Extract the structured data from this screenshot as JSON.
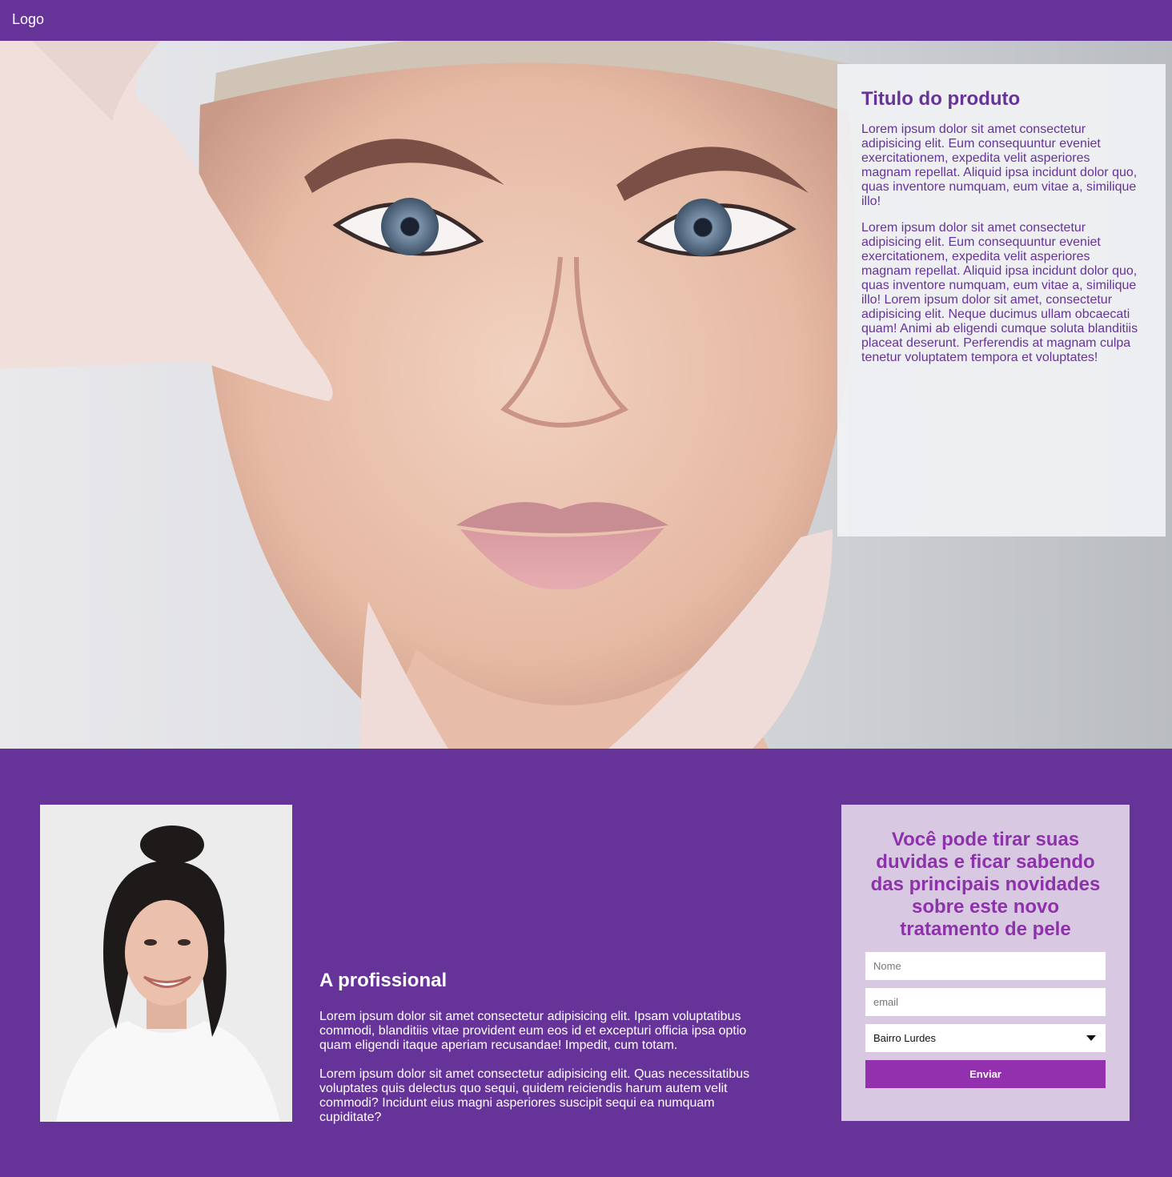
{
  "header": {
    "logo": "Logo"
  },
  "hero": {
    "image": "hero-photo",
    "product_title": "Titulo do produto",
    "paragraphs": [
      "Lorem ipsum dolor sit amet consectetur adipisicing elit. Eum consequuntur eveniet exercitationem, expedita velit asperiores magnam repellat. Aliquid ipsa incidunt dolor quo, quas inventore numquam, eum vitae a, similique illo!",
      "Lorem ipsum dolor sit amet consectetur adipisicing elit. Eum consequuntur eveniet exercitationem, expedita velit asperiores magnam repellat. Aliquid ipsa incidunt dolor quo, quas inventore numquam, eum vitae a, similique illo! Lorem ipsum dolor sit amet, consectetur adipisicing elit. Neque ducimus ullam obcaecati quam! Animi ab eligendi cumque soluta blanditiis placeat deserunt. Perferendis at magnam culpa tenetur voluptatem tempora et voluptates!"
    ]
  },
  "professional": {
    "image": "portrait-photo",
    "title": "A profissional",
    "paragraphs": [
      "Lorem ipsum dolor sit amet consectetur adipisicing elit. Ipsam voluptatibus commodi, blanditiis vitae provident eum eos id et excepturi officia ipsa optio quam eligendi itaque aperiam recusandae! Impedit, cum totam.",
      "Lorem ipsum dolor sit amet consectetur adipisicing elit. Quas necessitatibus voluptates quis delectus quo sequi, quidem reiciendis harum autem velit commodi? Incidunt eius magni asperiores suscipit sequi ea numquam cupiditate?"
    ]
  },
  "form": {
    "title": "Você pode tirar suas duvidas e ficar sabendo das principais novidades sobre este novo tratamento de pele",
    "name_placeholder": "Nome",
    "email_placeholder": "email",
    "neighborhood_selected": "Bairro Lurdes",
    "submit_label": "Enviar"
  },
  "colors": {
    "brand_purple": "#663399",
    "form_title_purple": "#8e32ac",
    "button_purple": "#9230ad",
    "form_background": "#d8c8e2"
  }
}
